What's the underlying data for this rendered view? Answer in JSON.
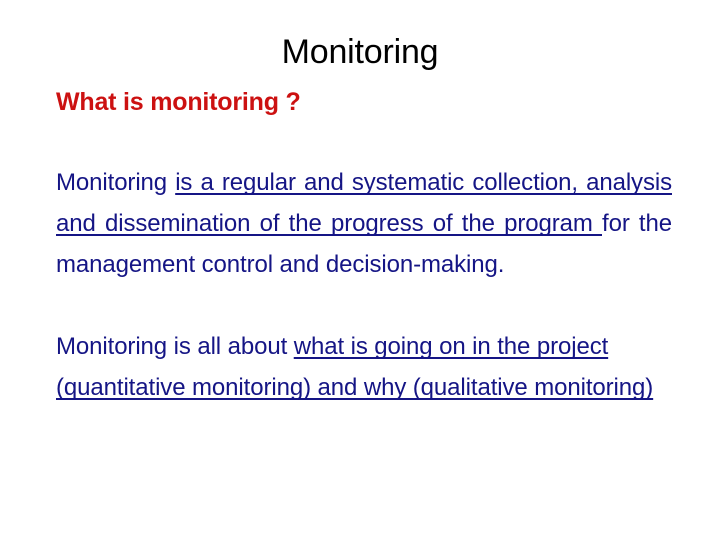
{
  "slide": {
    "title": "Monitoring",
    "heading": "What is monitoring ?",
    "colors": {
      "title": "#000000",
      "heading": "#CC1111",
      "body": "#151585",
      "background": "#FFFFFF"
    },
    "paragraphs": [
      {
        "id": "definition",
        "lead_plain": "Monitoring ",
        "underlined": "is a regular and systematic collection, analysis and dissemination of the progress of the program ",
        "tail_plain": "for the management control and decision-making.",
        "full_text": "Monitoring is a regular and systematic collection, analysis and dissemination of the progress of the program for the management control and decision-making."
      },
      {
        "id": "quant-qual",
        "lead_plain": "Monitoring is all about ",
        "underlined": "what is going on in the project (quantitative monitoring) and why (qualitative monitoring)",
        "tail_plain": "",
        "full_text": "Monitoring is all about what is going on in the project (quantitative monitoring) and why (qualitative monitoring)"
      }
    ]
  }
}
